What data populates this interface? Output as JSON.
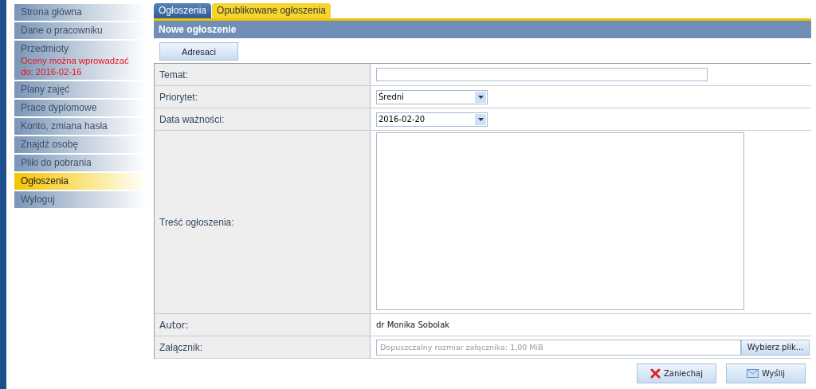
{
  "sidebar": {
    "items": [
      {
        "label": "Strona główna",
        "selected": false
      },
      {
        "label": "Dane o pracowniku",
        "selected": false
      },
      {
        "label": "Przedmioty",
        "note": "Oceny można wprowadzać do: 2016-02-16",
        "selected": false
      },
      {
        "label": "Plany zajęć",
        "selected": false
      },
      {
        "label": "Prace dyplomowe",
        "selected": false
      },
      {
        "label": "Konto, zmiana hasła",
        "selected": false
      },
      {
        "label": "Znajdź osobę",
        "selected": false
      },
      {
        "label": "Pliki do pobrania",
        "selected": false
      },
      {
        "label": "Ogłoszenia",
        "selected": true
      },
      {
        "label": "Wyloguj",
        "selected": false
      }
    ]
  },
  "tabs": [
    {
      "label": "Ogłoszenia",
      "selected": false
    },
    {
      "label": "Opublikowane ogłoszenia",
      "selected": true
    }
  ],
  "panel": {
    "title": "Nowe ogłoszenie",
    "recipients_button": "Adresaci",
    "fields": [
      {
        "kind": "text",
        "label": "Temat:"
      },
      {
        "kind": "select",
        "label": "Priorytet:",
        "value": "Średni"
      },
      {
        "kind": "select",
        "label": "Data ważności:",
        "value": "2016-02-20"
      },
      {
        "kind": "textarea",
        "label": "Treść ogłoszenia:"
      },
      {
        "kind": "static",
        "label": "Autor:",
        "value": "dr Monika Sobolak"
      },
      {
        "kind": "file",
        "label": "Załącznik:",
        "placeholder": "Dopuszczalny rozmiar załącznika: 1,00 MiB",
        "button": "Wybierz plik..."
      }
    ],
    "buttons": [
      {
        "kind": "cancel",
        "label": "Zaniechaj"
      },
      {
        "kind": "send",
        "label": "Wyślij"
      }
    ]
  }
}
